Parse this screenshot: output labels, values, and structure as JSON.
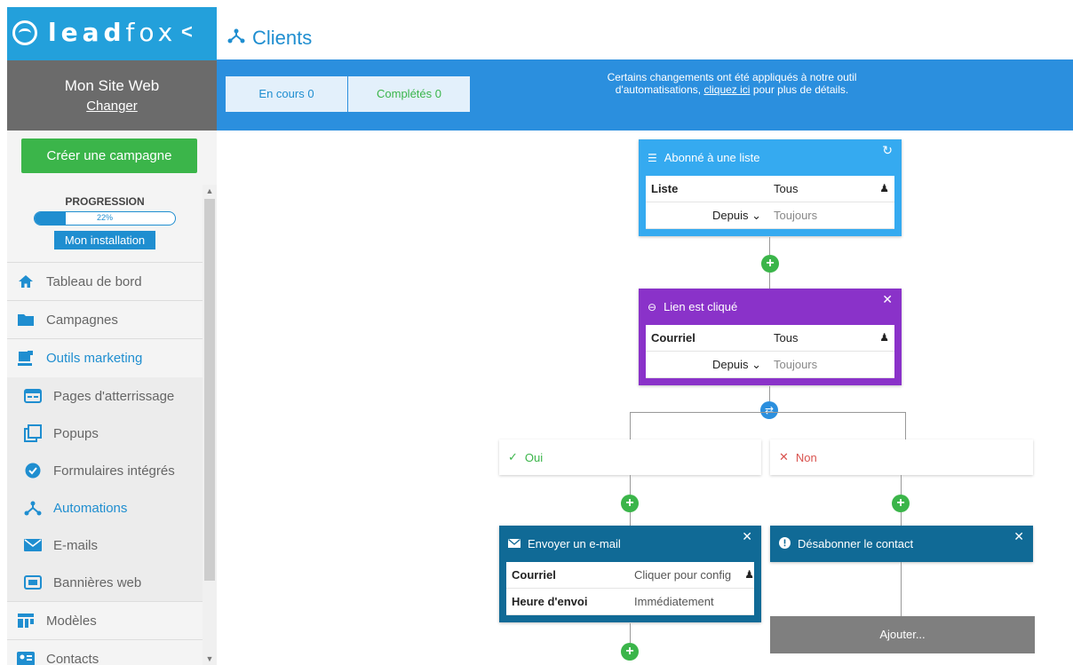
{
  "brand": {
    "logo_text_bold": "lead",
    "logo_text_rest": "fox",
    "collapse": "<"
  },
  "site": {
    "name": "Mon Site Web",
    "change": "Changer"
  },
  "sidebar": {
    "create_label": "Créer une campagne",
    "progress": {
      "label": "PROGRESSION",
      "percent": 22,
      "percent_text": "22%",
      "install_label": "Mon installation"
    },
    "items": [
      {
        "label": "Tableau de bord",
        "icon": "home-icon"
      },
      {
        "label": "Campagnes",
        "icon": "folder-icon"
      },
      {
        "label": "Outils marketing",
        "icon": "marketing-icon",
        "active": true
      }
    ],
    "subitems": [
      {
        "label": "Pages d'atterrissage",
        "icon": "landing-page-icon"
      },
      {
        "label": "Popups",
        "icon": "popup-icon"
      },
      {
        "label": "Formulaires intégrés",
        "icon": "check-circle-icon"
      },
      {
        "label": "Automations",
        "icon": "automation-icon",
        "active": true
      },
      {
        "label": "E-mails",
        "icon": "envelope-icon"
      },
      {
        "label": "Bannières web",
        "icon": "banner-icon"
      }
    ],
    "items_after": [
      {
        "label": "Modèles",
        "icon": "templates-icon"
      },
      {
        "label": "Contacts",
        "icon": "contacts-icon"
      }
    ]
  },
  "header": {
    "title": "Clients"
  },
  "tabs": {
    "in_progress": "En cours 0",
    "completed": "Complétés 0"
  },
  "notice": {
    "before": "Certains changements ont été appliqués à notre outil d'automatisations, ",
    "link": "cliquez ici",
    "after": " pour plus de détails."
  },
  "workflow": {
    "trigger": {
      "title": "Abonné à une liste",
      "row1_key": "Liste",
      "row1_val": "Tous",
      "row2_key": "Depuis ⌄",
      "row2_val": "Toujours"
    },
    "condition": {
      "title": "Lien est cliqué",
      "row1_key": "Courriel",
      "row1_val": "Tous",
      "row2_key": "Depuis ⌄",
      "row2_val": "Toujours"
    },
    "branch_yes": "Oui",
    "branch_no": "Non",
    "email_action": {
      "title": "Envoyer un e-mail",
      "row1_key": "Courriel",
      "row1_val": "Cliquer pour config",
      "row2_key": "Heure d'envoi",
      "row2_val": "Immédiatement"
    },
    "unsubscribe_action": {
      "title": "Désabonner le contact"
    },
    "add_label": "Ajouter..."
  },
  "colors": {
    "accent": "#2b8fde",
    "green": "#3bb54a",
    "purple": "#8a32c9",
    "dark_teal": "#106a96",
    "trigger_blue": "#35aaf0"
  }
}
